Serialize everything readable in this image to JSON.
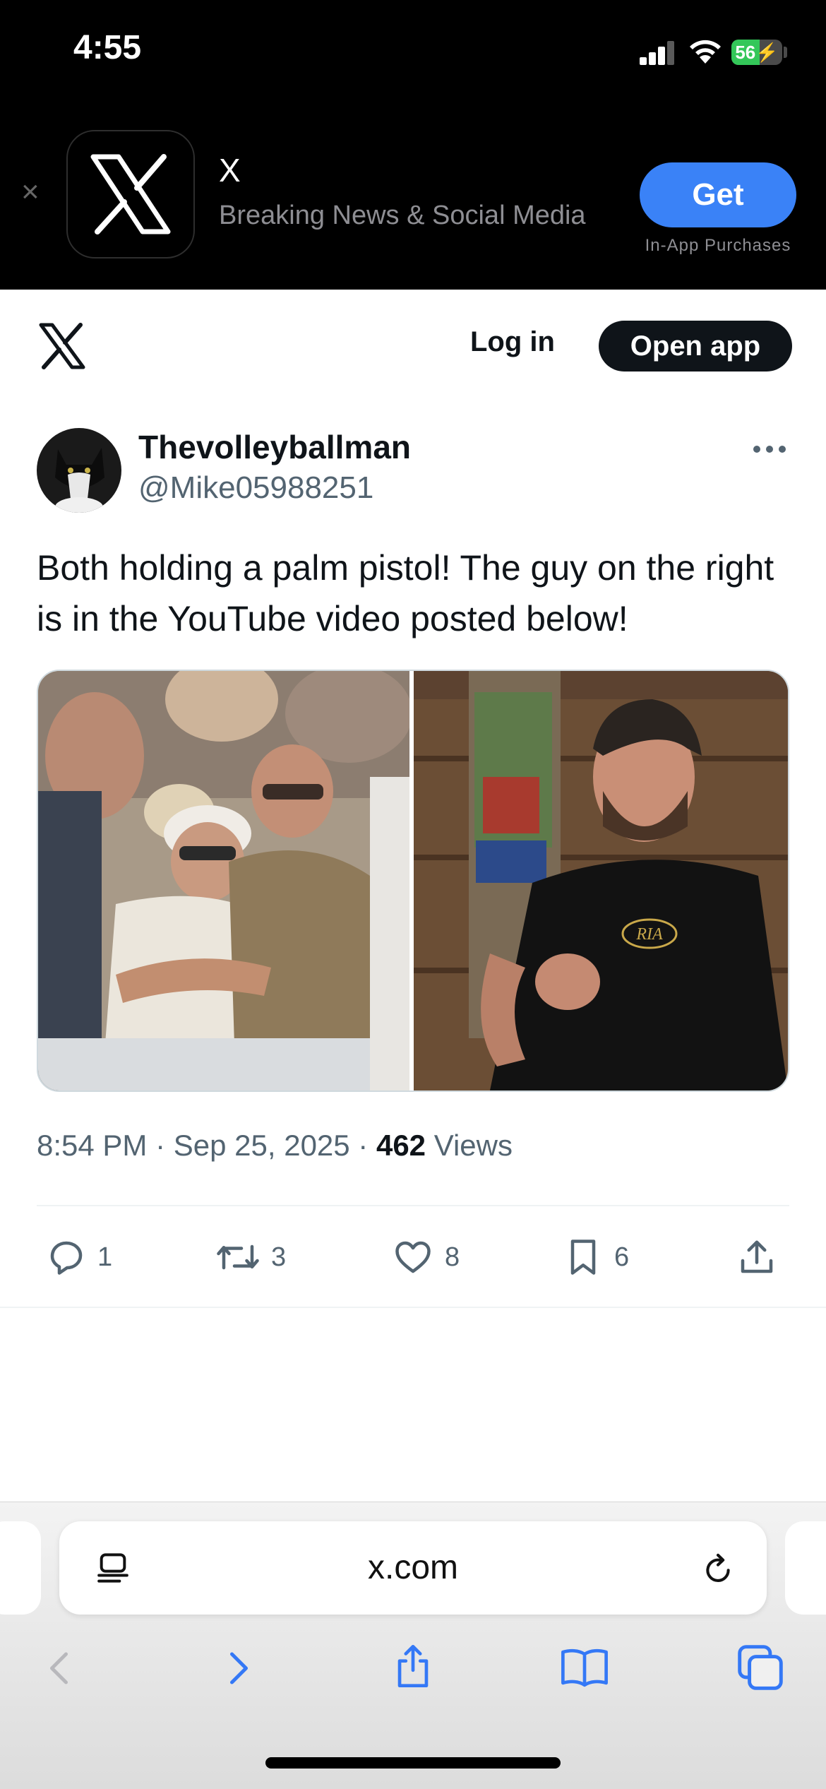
{
  "status_bar": {
    "time": "4:55",
    "battery_percent": 56,
    "battery_label": "56",
    "signal_bars": 3,
    "icons": [
      "cellular-signal-icon",
      "wifi-icon",
      "battery-charging-icon"
    ]
  },
  "app_banner": {
    "app_name": "X",
    "app_subtitle": "Breaking News & Social Media",
    "get_label": "Get",
    "iap_label": "In-App Purchases"
  },
  "site_header": {
    "login_label": "Log in",
    "open_app_label": "Open app"
  },
  "tweet": {
    "display_name": "Thevolleyballman",
    "handle": "@Mike05988251",
    "text": "Both holding a palm pistol! The guy on the right is in the YouTube video posted below!",
    "time": "8:54 PM",
    "date": "Sep 25, 2025",
    "views_count": "462",
    "views_label": "Views",
    "media": [
      {
        "description_icon": "crowd-photo"
      },
      {
        "description_icon": "man-black-polo-photo",
        "logo_text": "RIA"
      }
    ],
    "actions": {
      "replies": "1",
      "reposts": "3",
      "likes": "8",
      "bookmarks": "6"
    }
  },
  "browser": {
    "url": "x.com"
  },
  "colors": {
    "accent_blue": "#3a82f7",
    "x_black": "#0f1419",
    "secondary_text": "#536471",
    "safari_icon_blue": "#3478f6",
    "battery_green": "#34c759"
  }
}
